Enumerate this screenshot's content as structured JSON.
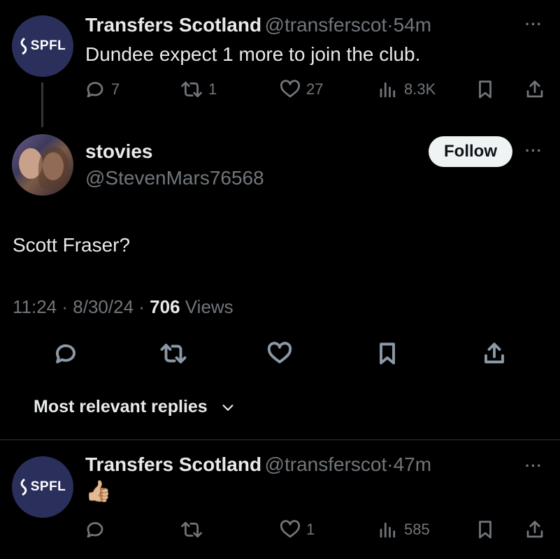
{
  "parent_tweet": {
    "name": "Transfers Scotland",
    "handle": "@transferscot",
    "sep": "·",
    "time": "54m",
    "text": "Dundee expect 1 more to join the club.",
    "avatar_text": "SPFL",
    "replies": "7",
    "retweets": "1",
    "likes": "27",
    "views": "8.3K",
    "more": "···"
  },
  "main_tweet": {
    "name": "stovies",
    "handle": "@StevenMars76568",
    "follow_label": "Follow",
    "more": "···",
    "text": "Scott Fraser?",
    "time": "11:24",
    "sep1": "·",
    "date": "8/30/24",
    "sep2": "·",
    "views_count": "706",
    "views_label": "Views"
  },
  "replies_sort": {
    "label": "Most relevant replies"
  },
  "reply_tweet": {
    "name": "Transfers Scotland",
    "handle": "@transferscot",
    "sep": "·",
    "time": "47m",
    "text": "👍🏼",
    "avatar_text": "SPFL",
    "likes": "1",
    "views": "585",
    "more": "···"
  },
  "colors": {
    "background": "#000000",
    "primary_text": "#e7e9ea",
    "secondary_text": "#71767b",
    "avatar_bg": "#2b2f5c",
    "follow_bg": "#eff3f4"
  },
  "icons": [
    "reply-icon",
    "retweet-icon",
    "like-icon",
    "views-icon",
    "bookmark-icon",
    "share-icon",
    "chevron-down-icon",
    "more-icon"
  ]
}
